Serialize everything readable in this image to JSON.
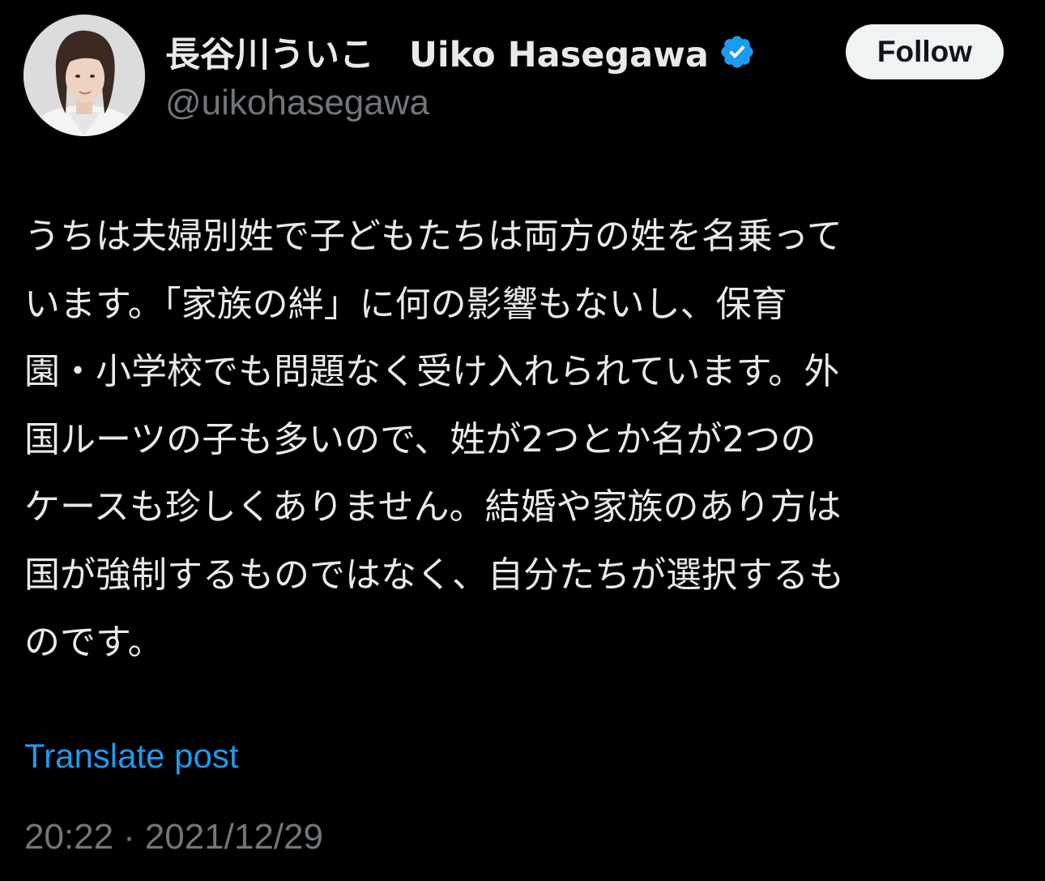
{
  "author": {
    "display_name": "長谷川ういこ　Uiko Hasegawa",
    "handle": "@uikohasegawa",
    "verified_icon": "verified-badge-icon",
    "avatar_icon": "profile-photo"
  },
  "follow_button": {
    "label": "Follow"
  },
  "tweet": {
    "lines": [
      "うちは夫婦別姓で子どもたちは両方の姓を名乗って",
      "います。「家族の絆」に何の影響もないし、保育",
      "園・小学校でも問題なく受け入れられています。外",
      "国ルーツの子も多いので、姓が2つとか名が2つの",
      "ケースも珍しくありません。結婚や家族のあり方は",
      "国が強制するものではなく、自分たちが選択するも",
      "のです。"
    ],
    "translate_label": "Translate post",
    "time": "20:22",
    "separator": "·",
    "date": "2021/12/29"
  },
  "colors": {
    "background": "#000000",
    "text": "#e7e9ea",
    "secondary": "#71767b",
    "link": "#1d9bf0",
    "verified": "#1d9bf0"
  }
}
